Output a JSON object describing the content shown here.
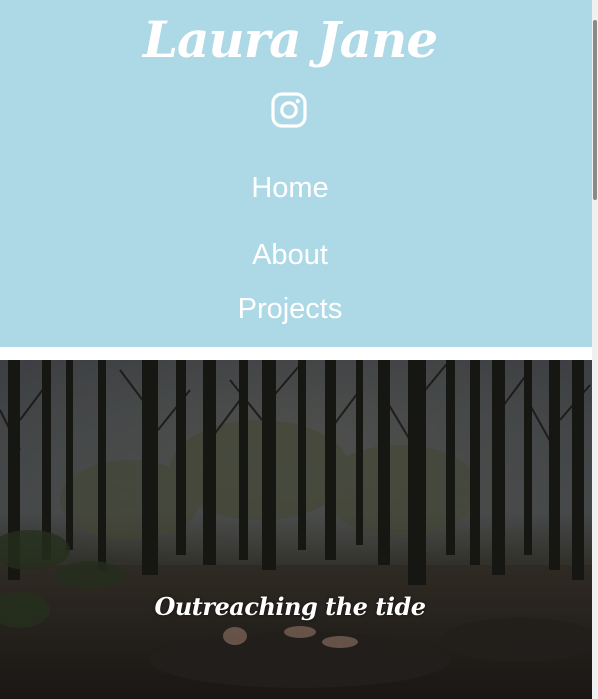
{
  "header": {
    "site_title": "Laura Jane",
    "social_icon": "instagram-icon",
    "background_color": "#add8e6",
    "text_color": "#ffffff"
  },
  "nav": {
    "items": [
      {
        "label": "Home"
      },
      {
        "label": "About"
      },
      {
        "label": "Projects"
      }
    ]
  },
  "hero": {
    "caption": "Outreaching the tide"
  }
}
